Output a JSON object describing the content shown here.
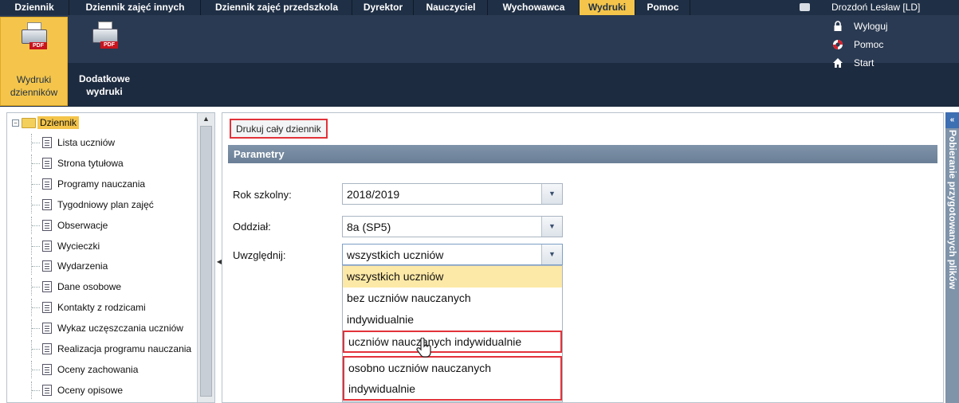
{
  "topnav": {
    "tabs": [
      {
        "label": "Dziennik"
      },
      {
        "label": "Dziennik zajęć innych"
      },
      {
        "label": "Dziennik zajęć przedszkola"
      },
      {
        "label": "Dyrektor"
      },
      {
        "label": "Nauczyciel"
      },
      {
        "label": "Wychowawca"
      },
      {
        "label": "Wydruki"
      },
      {
        "label": "Pomoc"
      }
    ],
    "active_tab": "Wydruki",
    "user": "Drozdoń Lesław [LD]"
  },
  "ribbon": {
    "buttons": [
      {
        "label_line1": "Wydruki",
        "label_line2": "dzienników",
        "icon": "pdf-printer-icon",
        "pdf_badge": "PDF"
      },
      {
        "label_line1": "Dodatkowe",
        "label_line2": "wydruki",
        "icon": "pdf-printer-icon",
        "pdf_badge": "PDF"
      }
    ],
    "links": {
      "logout": "Wyloguj",
      "help": "Pomoc",
      "start": "Start"
    }
  },
  "tree": {
    "root": "Dziennik",
    "items": [
      "Lista uczniów",
      "Strona tytułowa",
      "Programy nauczania",
      "Tygodniowy plan zajęć",
      "Obserwacje",
      "Wycieczki",
      "Wydarzenia",
      "Dane osobowe",
      "Kontakty z rodzicami",
      "Wykaz uczęszczania uczniów",
      "Realizacja programu nauczania",
      "Oceny zachowania",
      "Oceny opisowe"
    ]
  },
  "main": {
    "print_button": "Drukuj cały dziennik",
    "params_title": "Parametry",
    "fields": {
      "year_label": "Rok szkolny:",
      "year_value": "2018/2019",
      "class_label": "Oddział:",
      "class_value": "8a (SP5)",
      "include_label": "Uwzględnij:",
      "include_value": "wszystkich uczniów"
    },
    "dropdown_options": [
      {
        "line1": "wszystkich uczniów",
        "line2": ""
      },
      {
        "line1": "bez uczniów nauczanych",
        "line2": "indywidualnie"
      },
      {
        "line1": "uczniów nauczanych indywidualnie",
        "line2": ""
      },
      {
        "line1": "osobno uczniów nauczanych",
        "line2": "indywidualnie"
      }
    ]
  },
  "right_panel": {
    "label": "Pobieranie przygotowanych plików"
  },
  "colors": {
    "nav_bg": "#1f2f45",
    "active_yellow": "#f4c54a",
    "highlight_red": "#e2323a",
    "params_header": "#7f93a9"
  }
}
